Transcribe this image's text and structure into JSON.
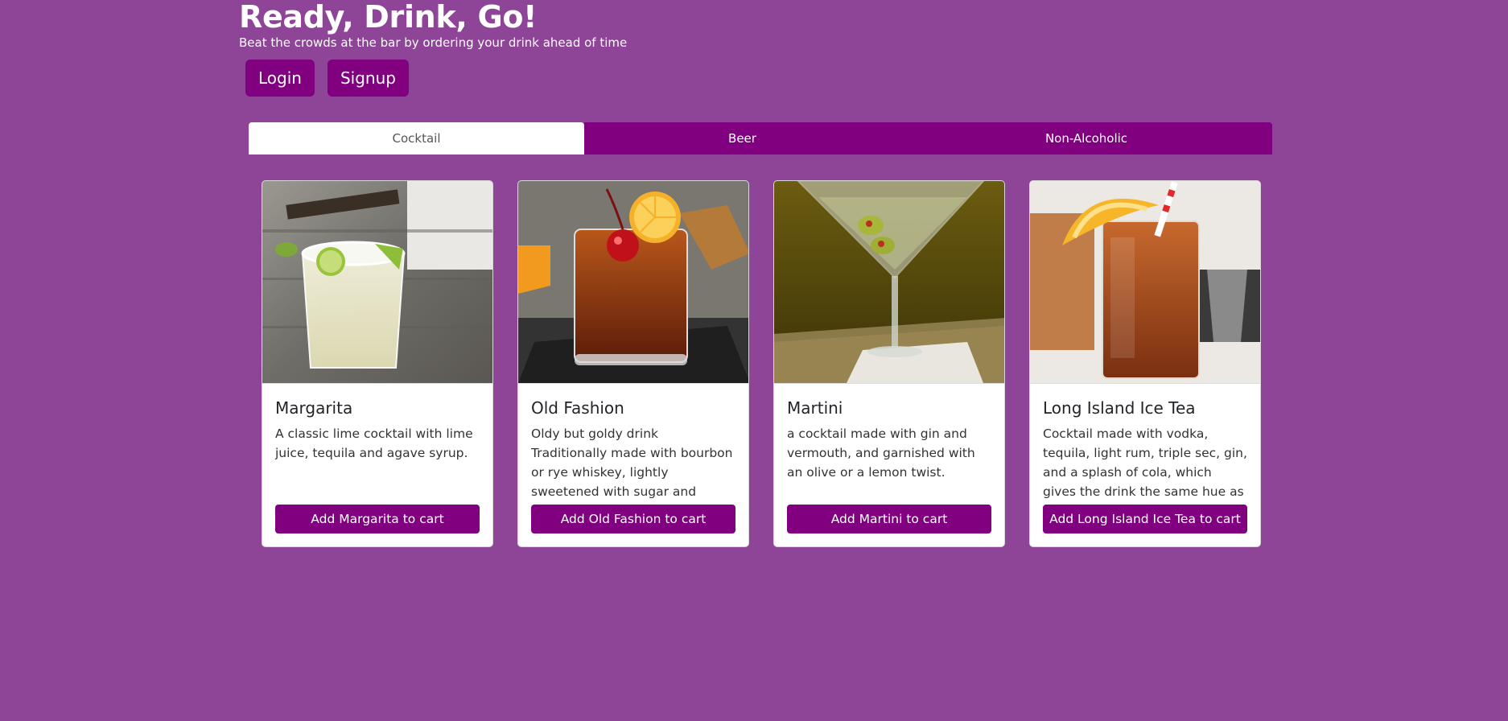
{
  "app": {
    "title": "Ready, Drink, Go!",
    "tagline": "Beat the crowds at the bar by ordering your drink ahead of time"
  },
  "auth": {
    "login_label": "Login",
    "signup_label": "Signup"
  },
  "tabs": [
    {
      "label": "Cocktail",
      "active": true
    },
    {
      "label": "Beer",
      "active": false
    },
    {
      "label": "Non-Alcoholic",
      "active": false
    }
  ],
  "drinks": [
    {
      "name": "Margarita",
      "description": "A classic lime cocktail with lime juice, tequila and agave syrup.",
      "button_label": "Add Margarita to cart",
      "image": "margarita-photo"
    },
    {
      "name": "Old Fashion",
      "description": "Oldy but goldy drink Traditionally made with bourbon or rye whiskey, lightly sweetened with sugar and aromatised with bitters.",
      "button_label": "Add Old Fashion to cart",
      "image": "old-fashion-photo"
    },
    {
      "name": "Martini",
      "description": "a cocktail made with gin and vermouth, and garnished with an olive or a lemon twist.",
      "button_label": "Add Martini to cart",
      "image": "martini-photo"
    },
    {
      "name": "Long Island Ice Tea",
      "description": "Cocktail made with vodka, tequila, light rum, triple sec, gin, and a splash of cola, which gives the drink the same hue as iced tea.",
      "button_label": "Add Long Island Ice Tea to cart",
      "image": "long-island-photo"
    }
  ],
  "colors": {
    "background": "#8e4497",
    "accent": "#800080",
    "card": "#ffffff"
  }
}
